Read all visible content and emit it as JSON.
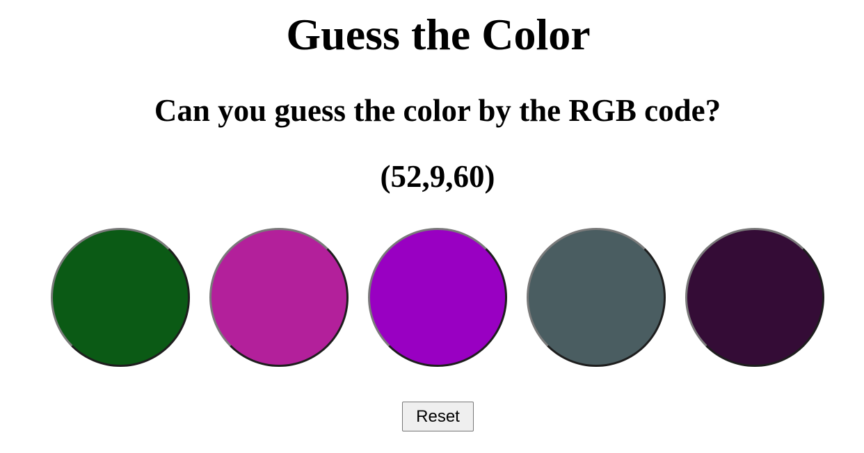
{
  "header": {
    "title": "Guess the Color",
    "subtitle": "Can you guess the color by the RGB code?",
    "rgb_code": "(52,9,60)"
  },
  "swatches": [
    {
      "color": "#0b5a15"
    },
    {
      "color": "#b3209b"
    },
    {
      "color": "#9900c2"
    },
    {
      "color": "#4a5d61"
    },
    {
      "color": "#340c36"
    }
  ],
  "controls": {
    "reset_label": "Reset"
  }
}
